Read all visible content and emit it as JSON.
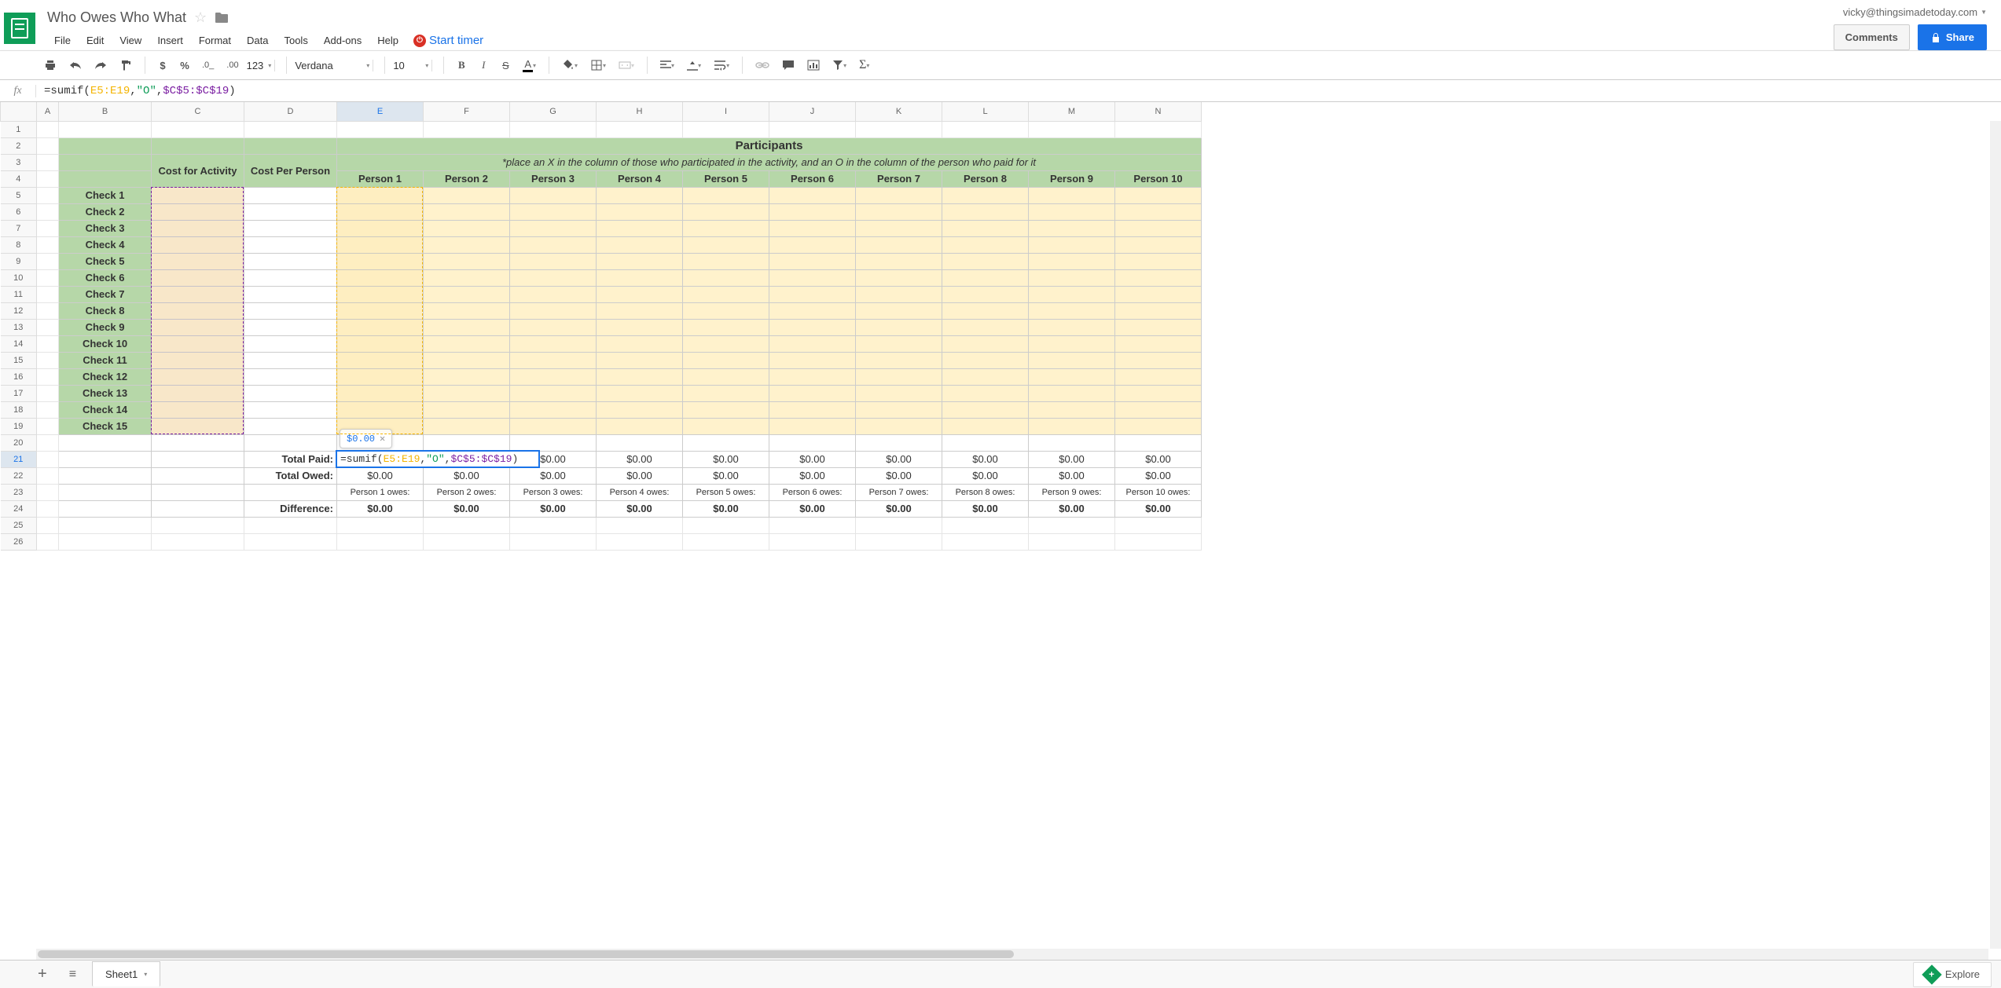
{
  "doc": {
    "title": "Who Owes Who What",
    "user_email": "vicky@thingsimadetoday.com",
    "comments_label": "Comments",
    "share_label": "Share",
    "timer_label": "Start timer"
  },
  "menus": [
    "File",
    "Edit",
    "View",
    "Insert",
    "Format",
    "Data",
    "Tools",
    "Add-ons",
    "Help"
  ],
  "toolbar": {
    "font": "Verdana",
    "font_size": "10",
    "number_format": "123"
  },
  "formula_bar": {
    "prefix": "=sumif(",
    "arg1": "E5:E19",
    "comma1": ",",
    "arg2": "\"O\"",
    "comma2": ",",
    "arg3": "$C$5:$C$19",
    "suffix": ")"
  },
  "columns": [
    "A",
    "B",
    "C",
    "D",
    "E",
    "F",
    "G",
    "H",
    "I",
    "J",
    "K",
    "L",
    "M",
    "N"
  ],
  "column_widths": {
    "A": 28,
    "B": 118,
    "C": 118,
    "D": 118,
    "E": 110,
    "F": 110,
    "G": 110,
    "H": 110,
    "I": 110,
    "J": 110,
    "K": 110,
    "L": 110,
    "M": 110,
    "N": 110
  },
  "active_cell": {
    "col": "E",
    "row": 21
  },
  "rows_visible": 26,
  "sheet": {
    "participants_title": "Participants",
    "participants_note": "*place an X in the column of those who participated in the activity, and an O in the column of the person who paid for it",
    "cost_for_activity": "Cost for Activity",
    "cost_per_person": "Cost Per Person",
    "persons": [
      "Person 1",
      "Person 2",
      "Person 3",
      "Person 4",
      "Person 5",
      "Person 6",
      "Person 7",
      "Person 8",
      "Person 9",
      "Person 10"
    ],
    "checks": [
      "Check 1",
      "Check 2",
      "Check 3",
      "Check 4",
      "Check 5",
      "Check 6",
      "Check 7",
      "Check 8",
      "Check 9",
      "Check 10",
      "Check 11",
      "Check 12",
      "Check 13",
      "Check 14",
      "Check 15"
    ],
    "total_paid_label": "Total Paid:",
    "total_owed_label": "Total Owed:",
    "difference_label": "Difference:",
    "owes_labels": [
      "Person 1 owes:",
      "Person 2 owes:",
      "Person 3 owes:",
      "Person 4 owes:",
      "Person 5 owes:",
      "Person 6 owes:",
      "Person 7 owes:",
      "Person 8 owes:",
      "Person 9 owes:",
      "Person 10 owes:"
    ],
    "zero": "$0.00",
    "tooltip_value": "$0.00"
  },
  "bottom": {
    "sheet_name": "Sheet1",
    "explore_label": "Explore"
  }
}
